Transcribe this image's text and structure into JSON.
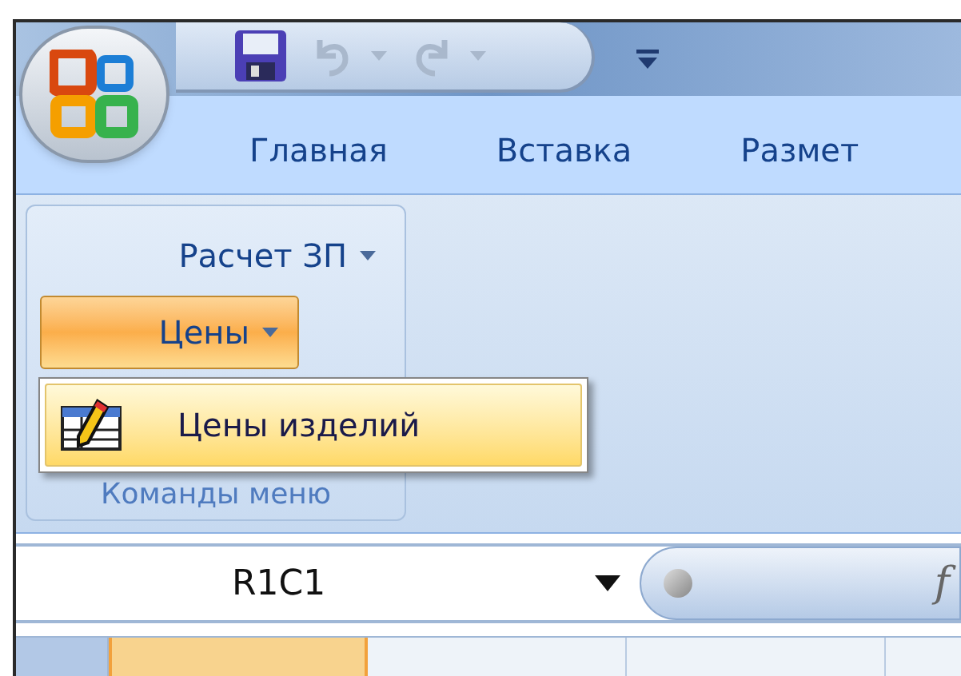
{
  "quick_access": {
    "undo_disabled": true,
    "redo_disabled": true
  },
  "tabs": [
    {
      "label": "Главная"
    },
    {
      "label": "Вставка"
    },
    {
      "label": "Размет"
    }
  ],
  "ribbon_group": {
    "title": "Команды меню",
    "items": [
      {
        "label": "Расчет ЗП",
        "expanded": false
      },
      {
        "label": "Цены",
        "expanded": true
      }
    ]
  },
  "dropdown_menu": {
    "items": [
      {
        "label": "Цены изделий",
        "selected": true
      }
    ]
  },
  "formula_bar": {
    "name_box": "R1C1",
    "fx_label": "f"
  },
  "column_headers": [
    {
      "selected": true
    },
    {
      "selected": false
    },
    {
      "selected": false
    },
    {
      "selected": false
    }
  ]
}
